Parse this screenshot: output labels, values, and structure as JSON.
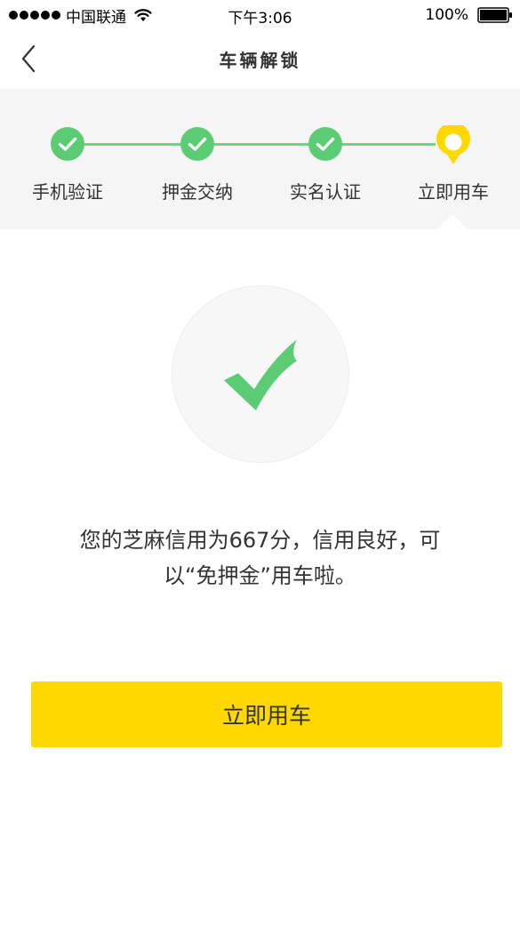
{
  "status_bar": {
    "carrier": "中国联通",
    "time": "下午3:06",
    "battery": "100%"
  },
  "nav": {
    "title": "车辆解锁"
  },
  "steps": [
    {
      "label": "手机验证",
      "state": "done"
    },
    {
      "label": "押金交纳",
      "state": "done"
    },
    {
      "label": "实名认证",
      "state": "done"
    },
    {
      "label": "立即用车",
      "state": "current"
    }
  ],
  "message": {
    "line1": "您的芝麻信用为667分，信用良好，可",
    "line2": "以“免押金”用车啦。"
  },
  "primary_button": {
    "label": "立即用车"
  },
  "colors": {
    "accent": "#ffd800",
    "success": "#5ccc74",
    "step_line": "#6ed08a",
    "current_step": "#ffd800"
  }
}
